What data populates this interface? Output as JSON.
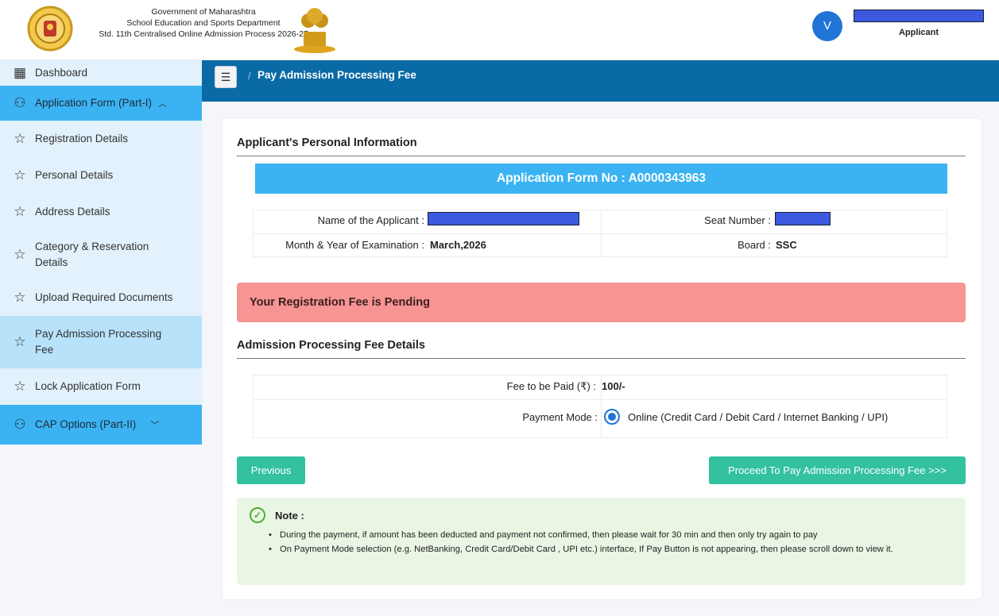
{
  "header": {
    "org_line1": "Government of Maharashtra",
    "org_line2": "School Education and Sports Department",
    "org_line3": "Std. 11th Centralised Online Admission Process 2026-27",
    "avatar_letter": "V",
    "user_role": "Applicant"
  },
  "sidebar": {
    "items": [
      {
        "label": "Dashboard",
        "icon": "dashboard-icon"
      },
      {
        "label": "Application Form (Part-I)",
        "icon": "users-icon"
      },
      {
        "label": "Registration Details",
        "icon": "star-icon"
      },
      {
        "label": "Personal Details",
        "icon": "star-icon"
      },
      {
        "label": "Address Details",
        "icon": "star-icon"
      },
      {
        "label": "Category & Reservation Details",
        "icon": "star-icon"
      },
      {
        "label": "Upload Required Documents",
        "icon": "star-icon"
      },
      {
        "label": "Pay Admission Processing Fee",
        "icon": "star-icon"
      },
      {
        "label": "Lock Application Form",
        "icon": "star-icon"
      },
      {
        "label": "CAP Options (Part-II)",
        "icon": "users-icon"
      }
    ]
  },
  "breadcrumb": {
    "separator": "/",
    "current": "Pay Admission Processing Fee"
  },
  "personal": {
    "section_title": "Applicant's Personal Information",
    "app_form_no": "Application Form No : A0000343963",
    "name_label": "Name of the Applicant :",
    "seat_label": "Seat Number :",
    "month_label": "Month & Year of Examination :",
    "month_value": "March,2026",
    "board_label": "Board :",
    "board_value": "SSC"
  },
  "alert": {
    "text": "Your Registration Fee is Pending"
  },
  "fee": {
    "section_title": "Admission Processing Fee Details",
    "fee_label": "Fee to be Paid (₹) :",
    "fee_value": "100/-",
    "mode_label": "Payment Mode :",
    "mode_value": "Online (Credit Card / Debit Card / Internet Banking / UPI)"
  },
  "buttons": {
    "previous": "Previous",
    "proceed": "Proceed To Pay Admission Processing Fee >>>"
  },
  "note": {
    "title": "Note :",
    "items": [
      "During the payment, if amount has been deducted and payment not confirmed, then please wait for 30 min and then only try again to pay",
      "On Payment Mode selection (e.g. NetBanking, Credit Card/Debit Card , UPI etc.) interface, If Pay Button is not appearing, then please scroll down to view it."
    ]
  },
  "colors": {
    "header_band": "#0a6aa6",
    "accent_blue": "#3bb3f2",
    "alert_bg": "#f79494",
    "button_green": "#33c1a0",
    "note_bg": "#eaf6e4"
  }
}
